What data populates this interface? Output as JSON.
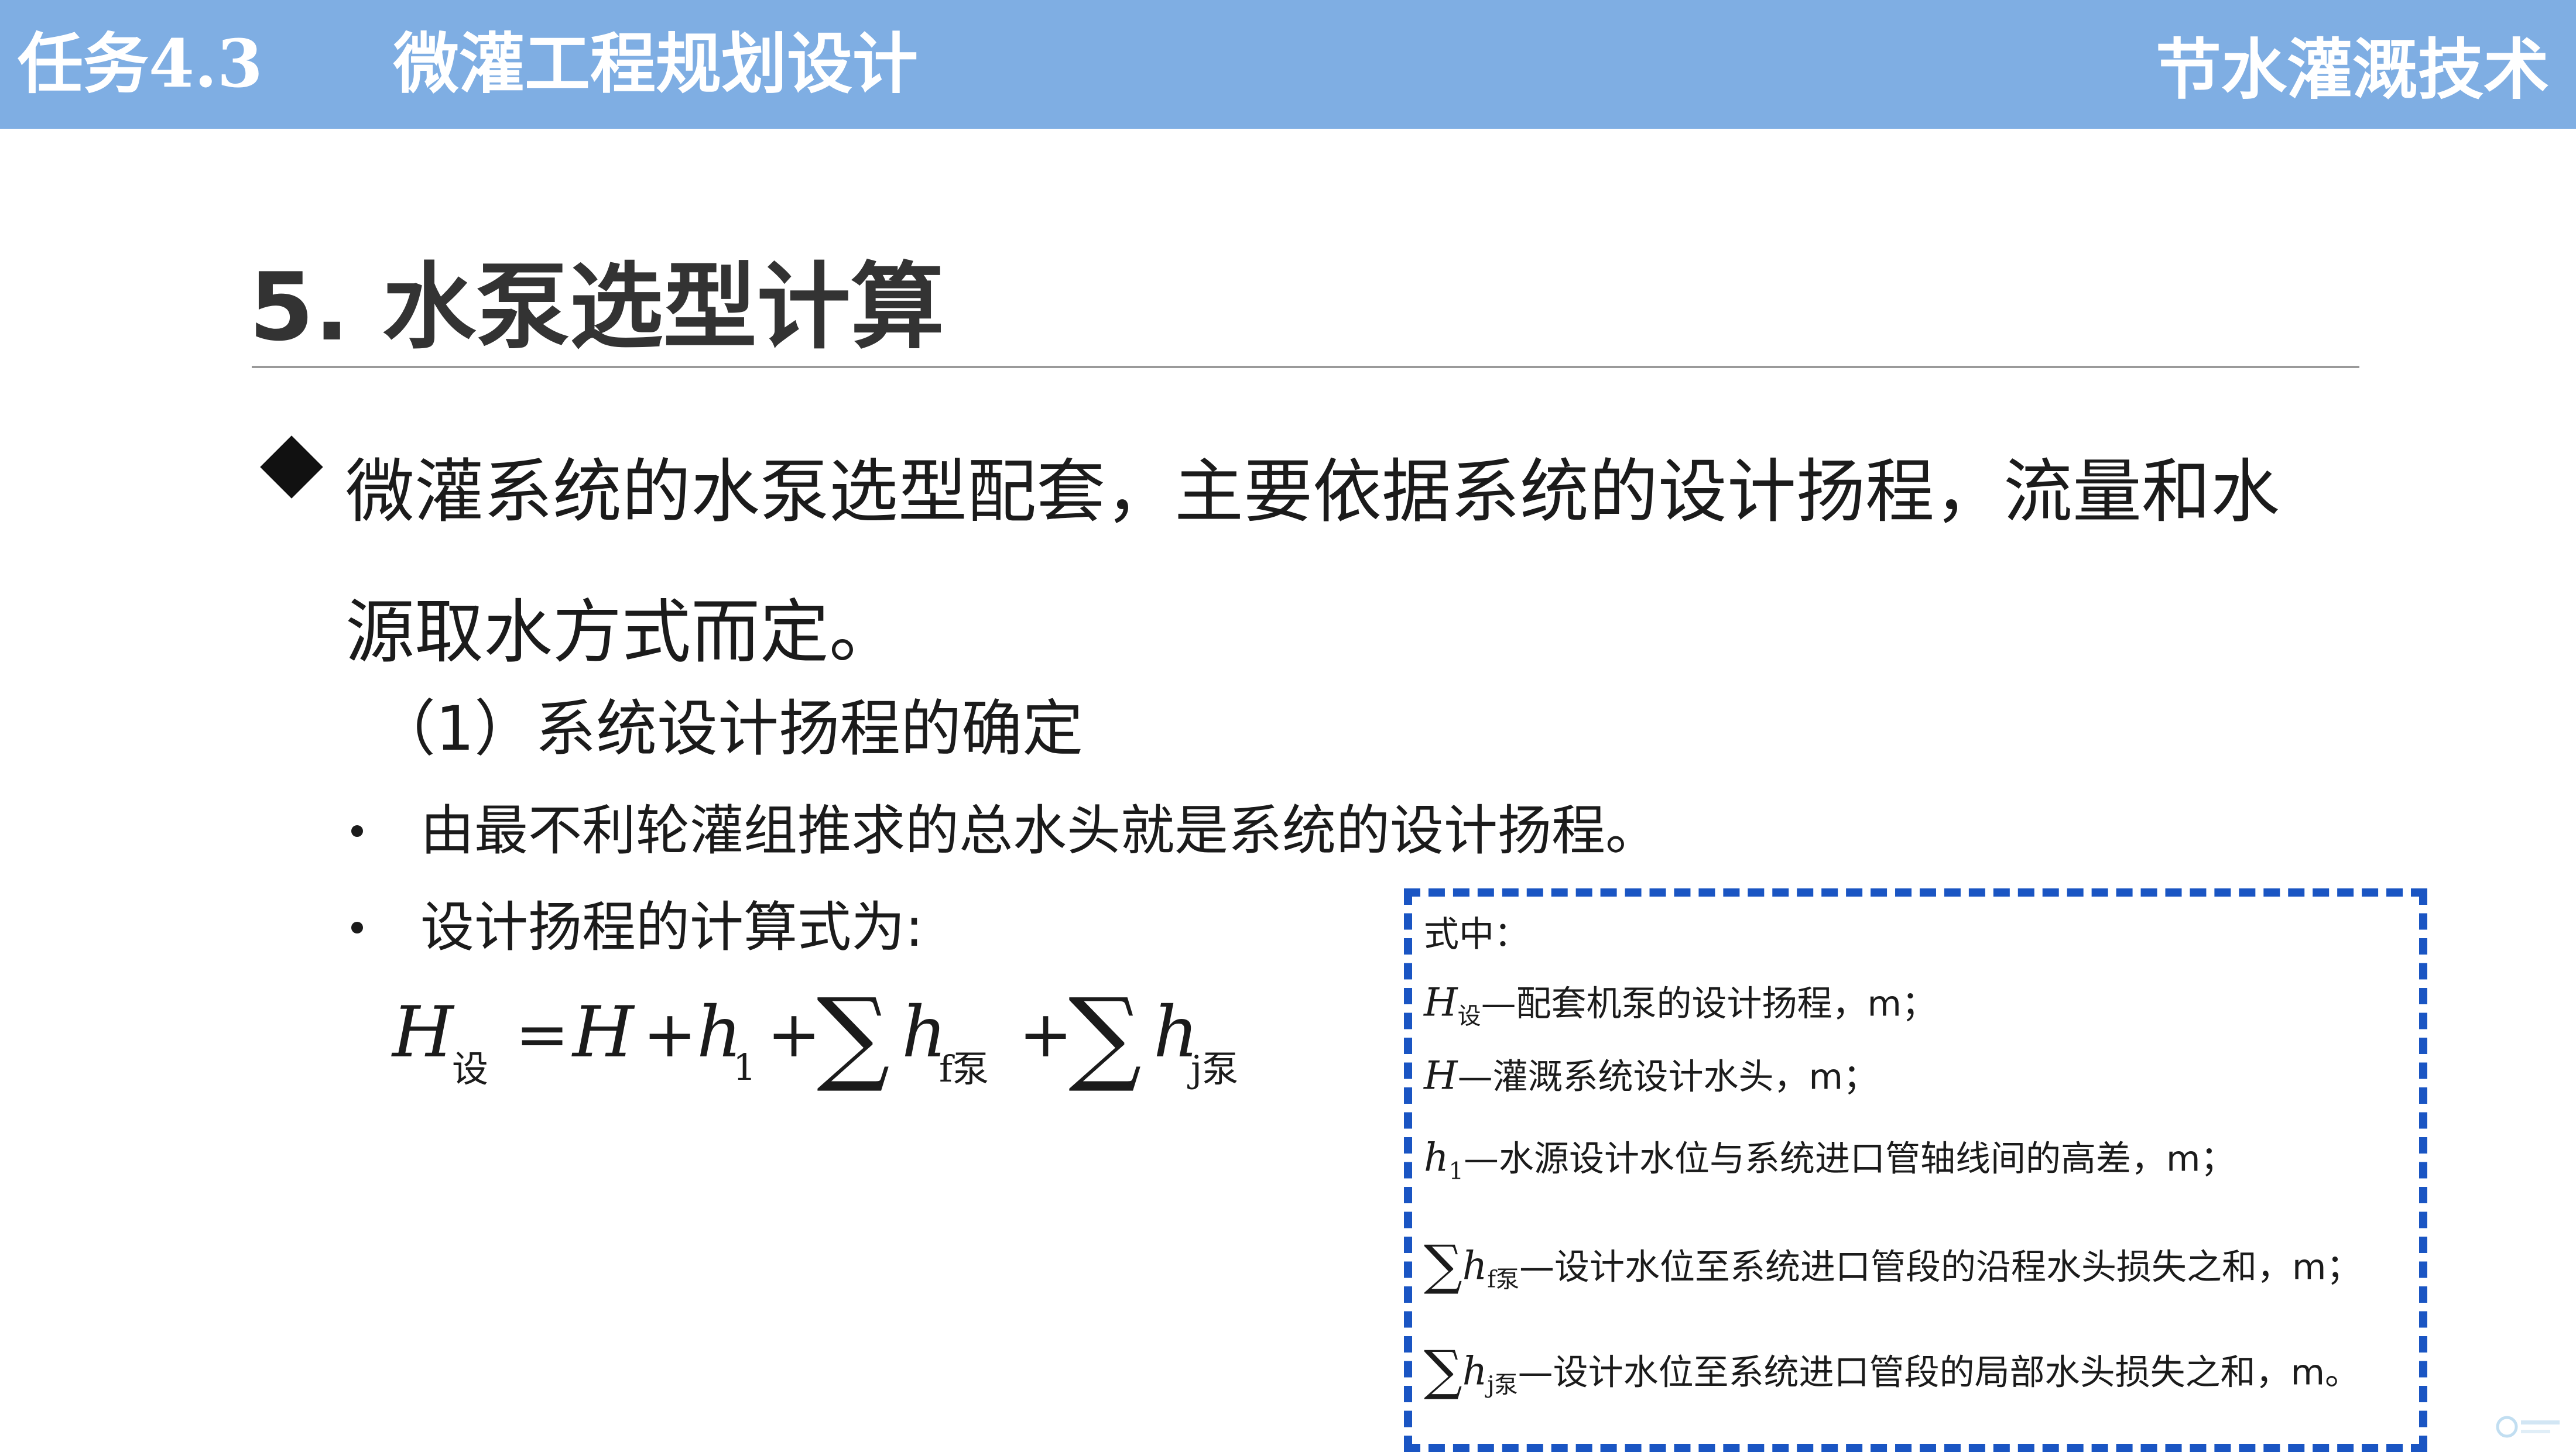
{
  "header": {
    "task": "任务4.3",
    "title": "微灌工程规划设计",
    "course": "节水灌溉技术"
  },
  "section": {
    "title": "5. 水泵选型计算"
  },
  "main": {
    "paragraph": "微灌系统的水泵选型配套，主要依据系统的设计扬程，流量和水源取水方式而定。",
    "subheading": "（1）系统设计扬程的确定",
    "bullets": [
      "由最不利轮灌组推求的总水头就是系统的设计扬程。",
      "设计扬程的计算式为:"
    ]
  },
  "formula": {
    "lhs": "H",
    "lhs_sub": "设",
    "eq": "=",
    "term_h": "H",
    "plus1": "+",
    "term_h1": "h",
    "term_h1_sub": "1",
    "plus2": "+",
    "sum1": "∑",
    "term_hf": "h",
    "term_hf_sub": "f泵",
    "plus3": "+",
    "sum2": "∑",
    "term_hj": "h",
    "term_hj_sub": "j泵"
  },
  "explanation": {
    "label": "式中：",
    "items": [
      {
        "sum": "",
        "symbol": "H",
        "sub": "设",
        "text": "—配套机泵的设计扬程，m；"
      },
      {
        "sum": "",
        "symbol": "H",
        "sub": "",
        "text": "—灌溉系统设计水头，m；"
      },
      {
        "sum": "",
        "symbol": "h",
        "sub": "1",
        "text": "—水源设计水位与系统进口管轴线间的高差，m；"
      },
      {
        "sum": "∑",
        "symbol": "h",
        "sub": "f泵",
        "text": "—设计水位至系统进口管段的沿程水头损失之和，m；"
      },
      {
        "sum": "∑",
        "symbol": "h",
        "sub": "j泵",
        "text": "—设计水位至系统进口管段的局部水头损失之和，m。"
      }
    ]
  },
  "colors": {
    "header_bg": "#7faee3",
    "box_border": "#1a55c3"
  }
}
